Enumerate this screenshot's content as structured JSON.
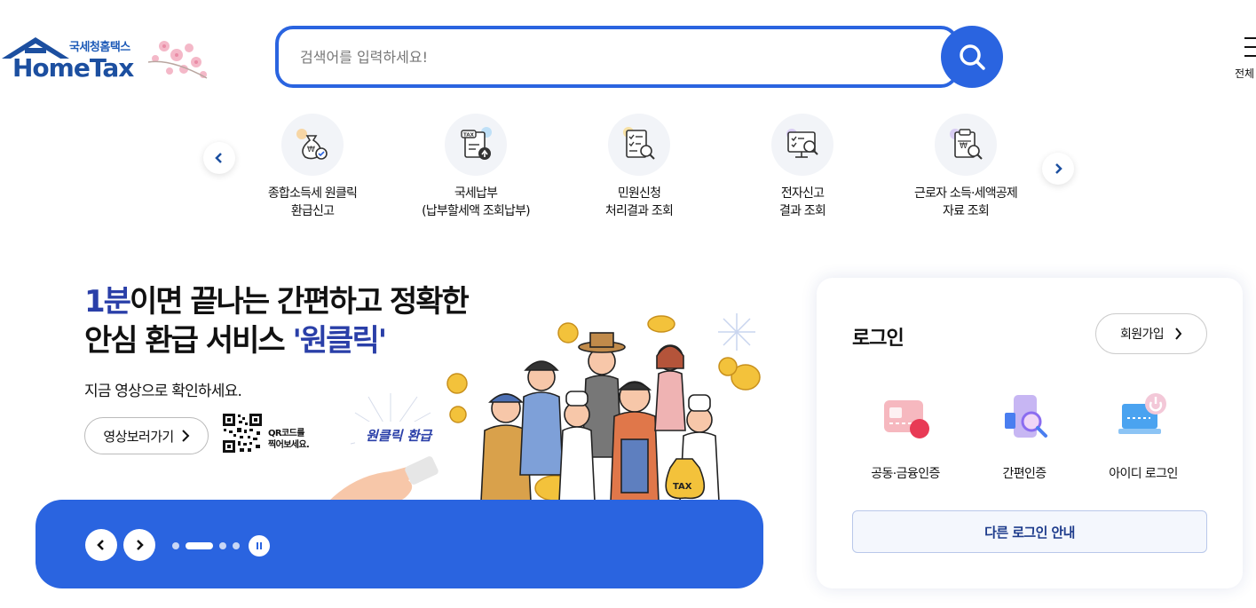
{
  "header": {
    "logo": {
      "sub": "국세청홈택스",
      "main": "HomeTax"
    },
    "search": {
      "placeholder": "검색어를 입력하세요!"
    },
    "menu_all_label": "전체"
  },
  "quick_menu": {
    "items": [
      {
        "line1": "종합소득세 원클릭",
        "line2": "환급신고",
        "icon": "money-bag-check-icon"
      },
      {
        "line1": "국세납부",
        "line2": "(납부할세액 조회납부)",
        "icon": "tax-bill-upload-icon"
      },
      {
        "line1": "민원신청",
        "line2": "처리결과 조회",
        "icon": "checklist-search-icon"
      },
      {
        "line1": "전자신고",
        "line2": "결과 조회",
        "icon": "monitor-search-icon"
      },
      {
        "line1": "근로자 소득·세액공제",
        "line2": "자료 조회",
        "icon": "receipt-search-icon"
      }
    ]
  },
  "banner": {
    "title_hl": "1분",
    "title_rest1": "이면 끝나는 간편하고 정확한",
    "title_line2": "안심 환급 서비스 ",
    "title_hl2": "'원클릭'",
    "subtitle": "지금 영상으로 확인하세요.",
    "video_button": "영상보러가기",
    "qr_note_line1": "QR코드를",
    "qr_note_line2": "찍어보세요.",
    "illust_badge": "원클릭 환급",
    "illust_tax": "TAX",
    "slide_count": 4,
    "active_slide": 2
  },
  "login": {
    "title": "로그인",
    "join_button": "회원가입",
    "options": [
      {
        "label": "공동·금융인증",
        "icon": "certificate-card-icon"
      },
      {
        "label": "간편인증",
        "icon": "phone-search-icon"
      },
      {
        "label": "아이디 로그인",
        "icon": "laptop-power-icon"
      }
    ],
    "other_button": "다른 로그인 안내"
  },
  "colors": {
    "primary": "#2a64e0",
    "title_highlight": "#2a3fa8",
    "logo_blue": "#1c4fa0",
    "icon_bg": "#f2f4f8",
    "other_login_text": "#1e3c8c"
  }
}
